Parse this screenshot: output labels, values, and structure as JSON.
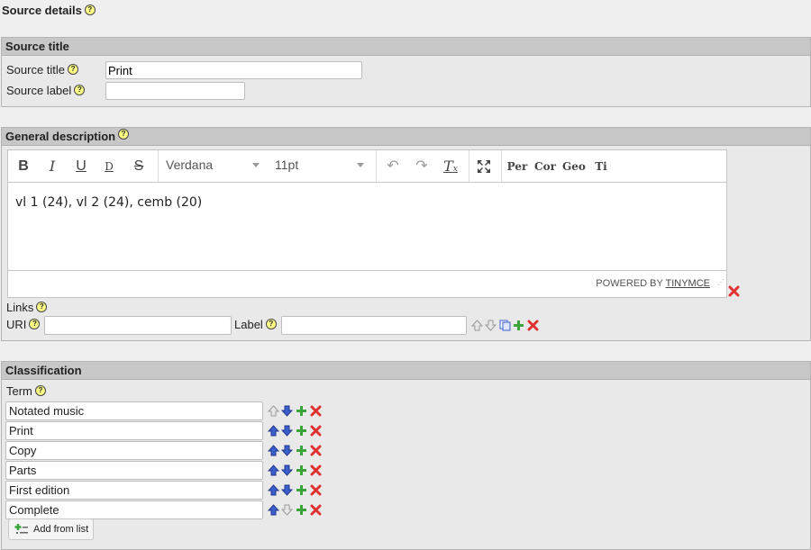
{
  "page": {
    "title": "Source details"
  },
  "source_title_panel": {
    "heading": "Source title",
    "title_label": "Source title",
    "title_value": "Print",
    "label_label": "Source label",
    "label_value": ""
  },
  "general_description": {
    "heading": "General description",
    "editor": {
      "font": "Verdana",
      "size": "11pt",
      "buttons": [
        "Per",
        "Cor",
        "Geo",
        "Ti"
      ],
      "content": "vl 1 (24), vl 2 (24), cemb (20)",
      "powered_by": "POWERED BY",
      "brand": "TINYMCE"
    },
    "links_label": "Links",
    "uri_label": "URI",
    "uri_value": "",
    "label_label": "Label",
    "label_value": ""
  },
  "classification": {
    "heading": "Classification",
    "term_label": "Term",
    "terms": [
      "Notated music",
      "Print",
      "Copy",
      "Parts",
      "First edition",
      "Complete"
    ],
    "add_from_list": "Add from list"
  },
  "colors": {
    "panel_header": "#c7c7c7",
    "panel_bg": "#e9e9e9",
    "arrow_blue": "#3a5fcd",
    "plus_green": "#3aa33a",
    "delete_red": "#e03030"
  }
}
